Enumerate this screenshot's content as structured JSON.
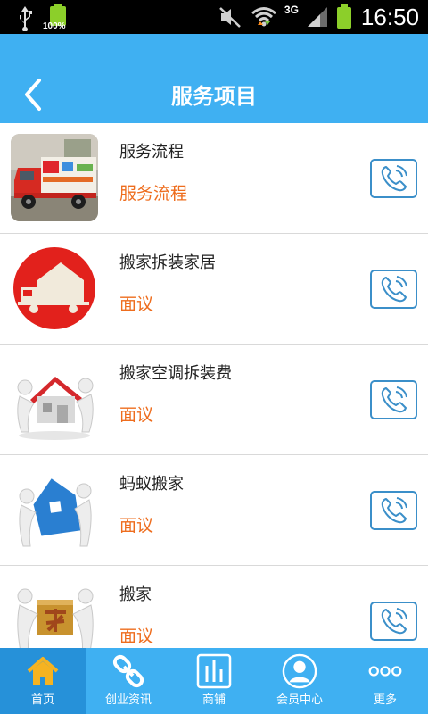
{
  "status_bar": {
    "battery_small_pct": "100%",
    "network": "3G",
    "time": "16:50",
    "icons": [
      "usb-icon",
      "battery-full-icon",
      "mute-icon",
      "wifi-icon",
      "signal-icon",
      "battery-icon"
    ]
  },
  "header": {
    "title": "服务项目",
    "back_icon": "chevron-left-icon",
    "background_color": "#3fb0f2"
  },
  "list": {
    "items": [
      {
        "name": "服务流程",
        "price": "服务流程",
        "image": "moving-truck-photo",
        "action_icon": "phone-icon"
      },
      {
        "name": "搬家拆装家居",
        "price": "面议",
        "image": "house-truck-logo",
        "action_icon": "phone-icon"
      },
      {
        "name": "搬家空调拆装费",
        "price": "面议",
        "image": "figures-carrying-red-roof-house",
        "action_icon": "phone-icon"
      },
      {
        "name": "蚂蚁搬家",
        "price": "面议",
        "image": "figures-carrying-blue-house",
        "action_icon": "phone-icon"
      },
      {
        "name": "搬家",
        "price": "面议",
        "image": "figures-carrying-jia-block",
        "action_icon": "phone-icon"
      }
    ],
    "price_color": "#ee6d1e"
  },
  "bottom_nav": {
    "items": [
      {
        "label": "首页",
        "icon": "home-icon",
        "active": true
      },
      {
        "label": "创业资讯",
        "icon": "link-icon",
        "active": false
      },
      {
        "label": "商铺",
        "icon": "chart-bars-icon",
        "active": false
      },
      {
        "label": "会员中心",
        "icon": "user-icon",
        "active": false
      },
      {
        "label": "更多",
        "icon": "more-dots-icon",
        "active": false
      }
    ]
  }
}
